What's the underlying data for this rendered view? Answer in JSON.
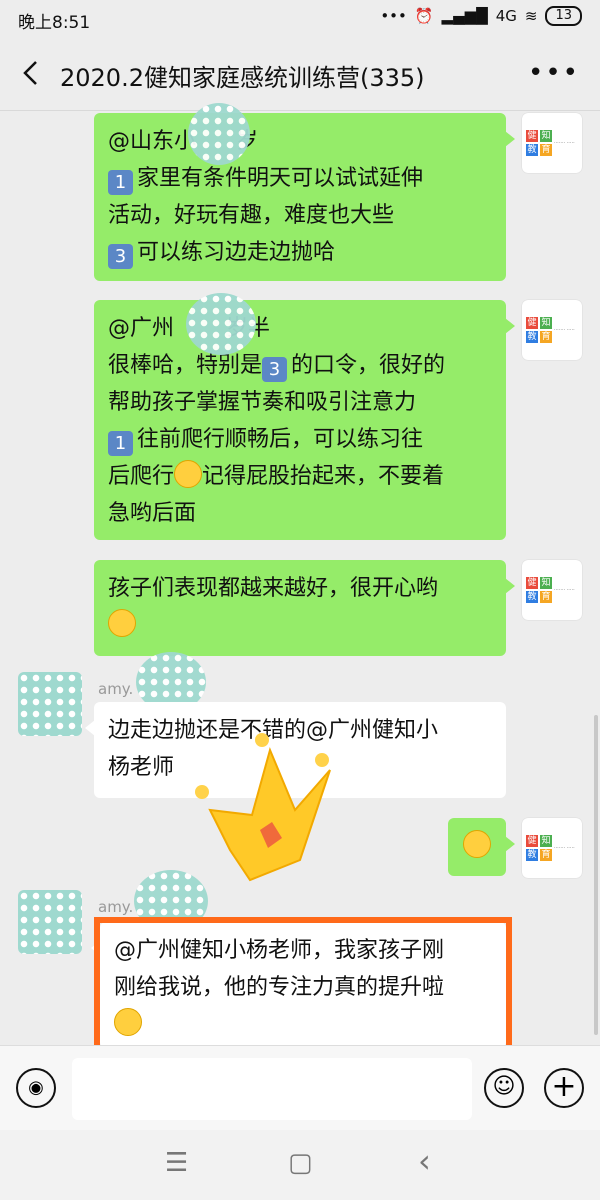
{
  "status_bar": {
    "time": "晚上8:51",
    "icons": [
      "more-dots",
      "alarm",
      "signal",
      "4G",
      "wifi"
    ],
    "network": "4G",
    "battery": "13"
  },
  "header": {
    "title": "2020.2健知家庭感统训练营(335)",
    "more": "•••"
  },
  "messages": [
    {
      "side": "right",
      "lines": [
        "@山东小",
        "1️⃣ 家里有条件明天可以试试延伸",
        "活动，好玩有趣，难度也大些",
        "3️⃣ 可以练习边走边抛哈"
      ],
      "mention": "@山东小",
      "mention_suffix": "岁",
      "line1": "家里有条件明天可以试试延伸",
      "line2": "活动，好玩有趣，难度也大些",
      "line3": "可以练习边走边抛哈"
    },
    {
      "side": "right",
      "mention": "@广州",
      "mention_suffix": "岁半",
      "line1a": "很棒哈，特别是",
      "line1b": "的口令，很好的",
      "line2": "帮助孩子掌握节奏和吸引注意力",
      "line3": "往前爬行顺畅后，可以练习往",
      "line4a": "后爬行",
      "line4b": "记得屁股抬起来，不要着",
      "line5": "急哟后面"
    },
    {
      "side": "right",
      "line1": "孩子们表现都越来越好，很开心哟"
    },
    {
      "side": "left",
      "sender": "amy.",
      "line1": "边走边抛还是不错的@广州健知小",
      "line2": "杨老师"
    },
    {
      "side": "right",
      "emoji": "smile"
    },
    {
      "side": "left",
      "sender": "amy.",
      "line1": "@广州健知小杨老师，我家孩子刚",
      "line2": "刚给我说，他的专注力真的提升啦"
    }
  ],
  "avatar_logo": {
    "tiles": [
      "健",
      "知",
      "教",
      "育"
    ],
    "colors": [
      "#e94b3c",
      "#4caf50",
      "#2f7de1",
      "#f5a623"
    ]
  },
  "keycaps": {
    "one": "1",
    "three": "3"
  },
  "input_bar": {
    "voice": "voice",
    "emoji": "emoji",
    "plus": "+"
  },
  "nav": {
    "menu": "☰",
    "home": "▢",
    "back": "‹"
  },
  "colors": {
    "bubble_mine": "#95ec69",
    "bubble_other": "#ffffff",
    "highlight": "#ff6a1a",
    "background": "#ededed"
  }
}
